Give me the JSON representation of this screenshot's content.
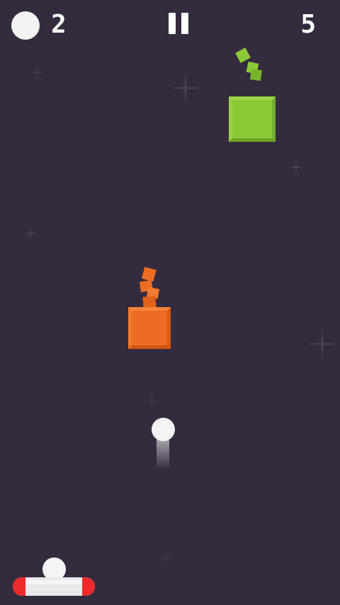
{
  "hud": {
    "balls_count": "2",
    "score": "5",
    "ball_icon": "ball-icon",
    "pause_icon": "pause-icon"
  },
  "colors": {
    "background": "#342b3e",
    "green_block": "#8bc937",
    "orange_block": "#ec6d21",
    "paddle_body": "#e9e9ec",
    "paddle_caps": "#ee2a2a",
    "ball": "#f4f4f4"
  },
  "blocks": [
    {
      "name": "green-block",
      "color": "#8bc937",
      "state": "breaking"
    },
    {
      "name": "orange-block",
      "color": "#ec6d21",
      "state": "breaking"
    }
  ]
}
